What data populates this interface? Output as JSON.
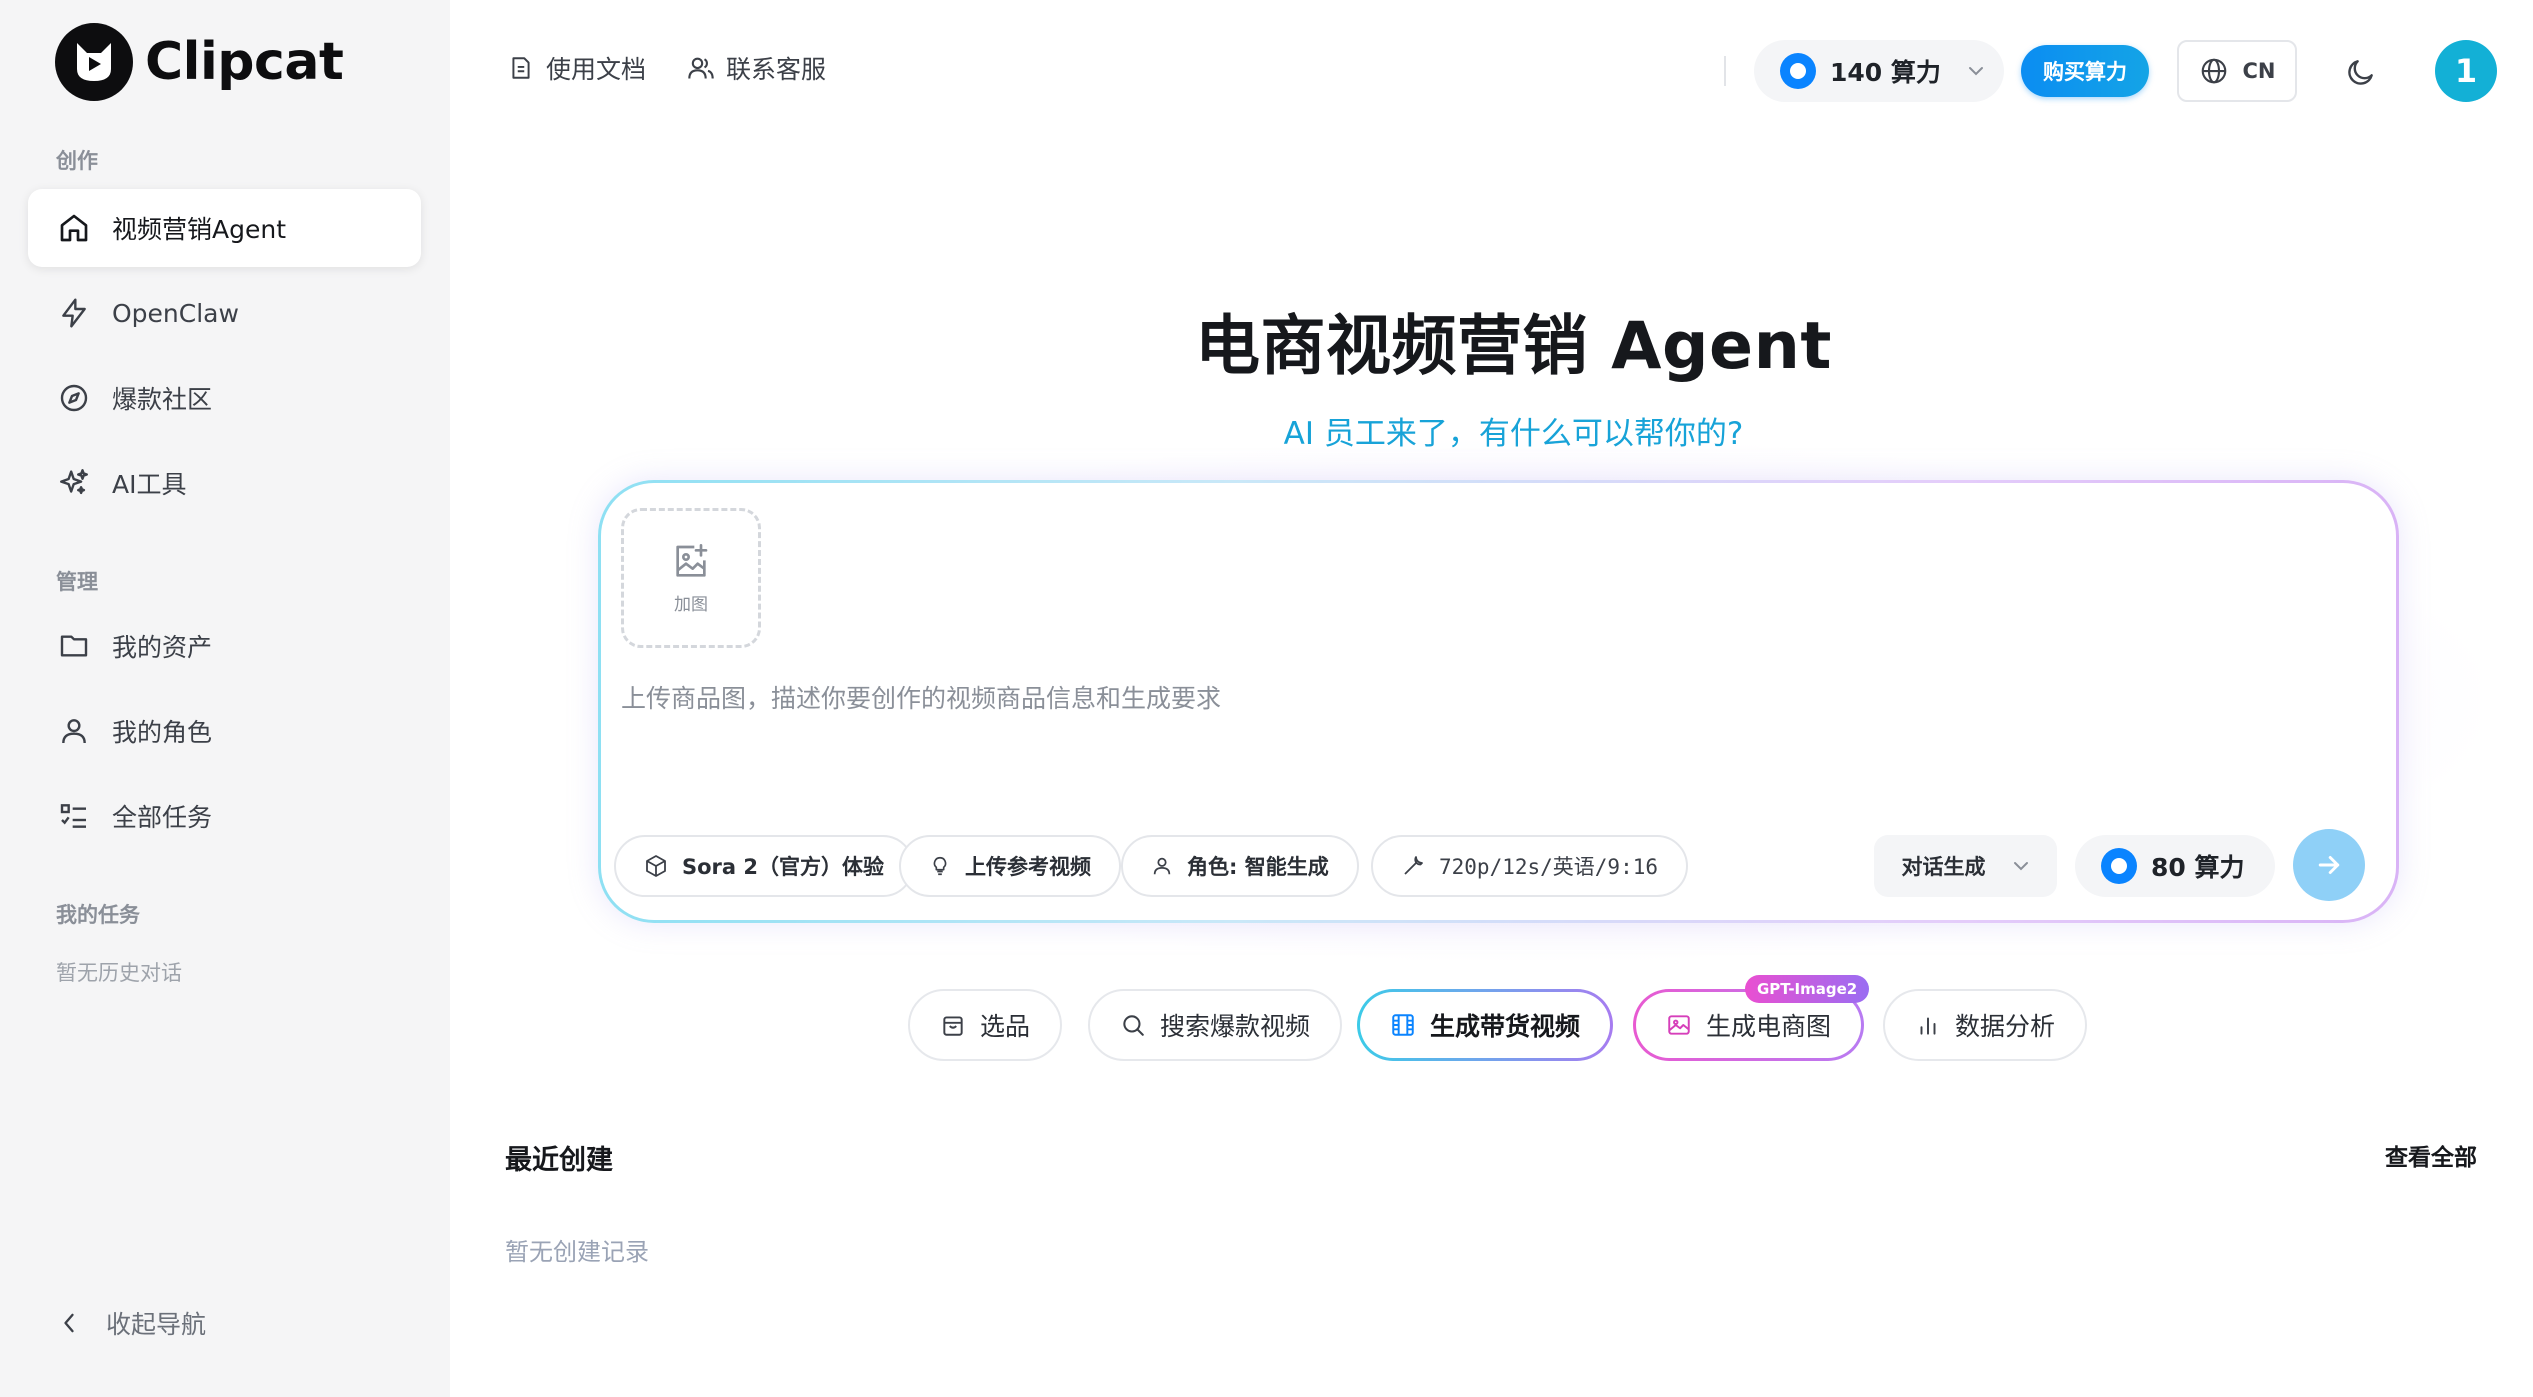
{
  "brand": {
    "name": "Clipcat"
  },
  "sidebar": {
    "sections": {
      "create": "创作",
      "manage": "管理",
      "tasks": "我的任务"
    },
    "create_items": [
      {
        "label": "视频营销Agent",
        "icon": "home-icon",
        "active": true
      },
      {
        "label": "OpenClaw",
        "icon": "lightning-icon"
      },
      {
        "label": "爆款社区",
        "icon": "compass-icon"
      },
      {
        "label": "AI工具",
        "icon": "sparkles-icon"
      }
    ],
    "manage_items": [
      {
        "label": "我的资产",
        "icon": "folder-icon"
      },
      {
        "label": "我的角色",
        "icon": "user-icon"
      },
      {
        "label": "全部任务",
        "icon": "task-list-icon"
      }
    ],
    "no_history": "暂无历史对话",
    "collapse_label": "收起导航"
  },
  "topbar": {
    "docs": "使用文档",
    "support": "联系客服",
    "credits": "140 算力",
    "buy": "购买算力",
    "lang": "CN",
    "avatar": "1"
  },
  "hero": {
    "title": "电商视频营销 Agent",
    "subtitle": "AI 员工来了，有什么可以帮你的?"
  },
  "composer": {
    "add_image": "加图",
    "placeholder": "上传商品图，描述你要创作的视频商品信息和生成要求",
    "chips": {
      "model": "Sora 2（官方）体验",
      "reference": "上传参考视频",
      "role": "角色: 智能生成",
      "params": "720p/12s/英语/9:16"
    },
    "mode": "对话生成",
    "cost": "80 算力"
  },
  "quick_actions": {
    "select": "选品",
    "search": "搜索爆款视频",
    "gen_video": "生成带货视频",
    "gen_image": "生成电商图",
    "analytics": "数据分析",
    "badge": "GPT-Image2"
  },
  "recent": {
    "title": "最近创建",
    "view_all": "查看全部",
    "empty": "暂无创建记录"
  },
  "colors": {
    "accent": "#0a84ff",
    "subtitle": "#17a3d8",
    "avatar": "#13b0d6",
    "badge_gradient_start": "#e94fd1"
  }
}
